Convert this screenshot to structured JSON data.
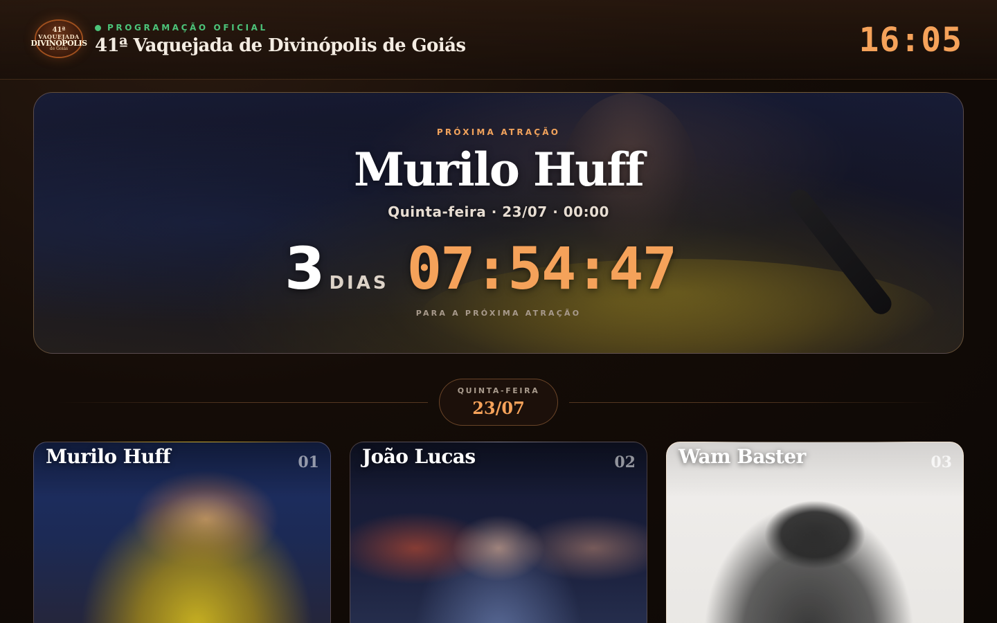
{
  "header": {
    "logo": {
      "line1": "41ª",
      "line2": "VAQUEJADA",
      "line3": "DIVINÓPOLIS",
      "line4": "de Goiás"
    },
    "kicker": "PROGRAMAÇÃO OFICIAL",
    "title": "41ª Vaquejada de Divinópolis de Goiás",
    "clock": "16:05"
  },
  "hero": {
    "label": "PRÓXIMA ATRAÇÃO",
    "artist": "Murilo Huff",
    "when": "Quinta-feira · 23/07 · 00:00",
    "countdown": {
      "days": "3",
      "days_label": "DIAS",
      "time": "07:54:47"
    },
    "subtitle": "PARA A PRÓXIMA ATRAÇÃO"
  },
  "day": {
    "weekday": "QUINTA-FEIRA",
    "date": "23/07"
  },
  "cards": [
    {
      "name": "Murilo Huff",
      "number": "01"
    },
    {
      "name": "João Lucas",
      "number": "02"
    },
    {
      "name": "Wam Baster",
      "number": "03"
    }
  ],
  "colors": {
    "accent": "#f5a25a",
    "live_green": "#4cc47a",
    "background": "#140c07"
  }
}
